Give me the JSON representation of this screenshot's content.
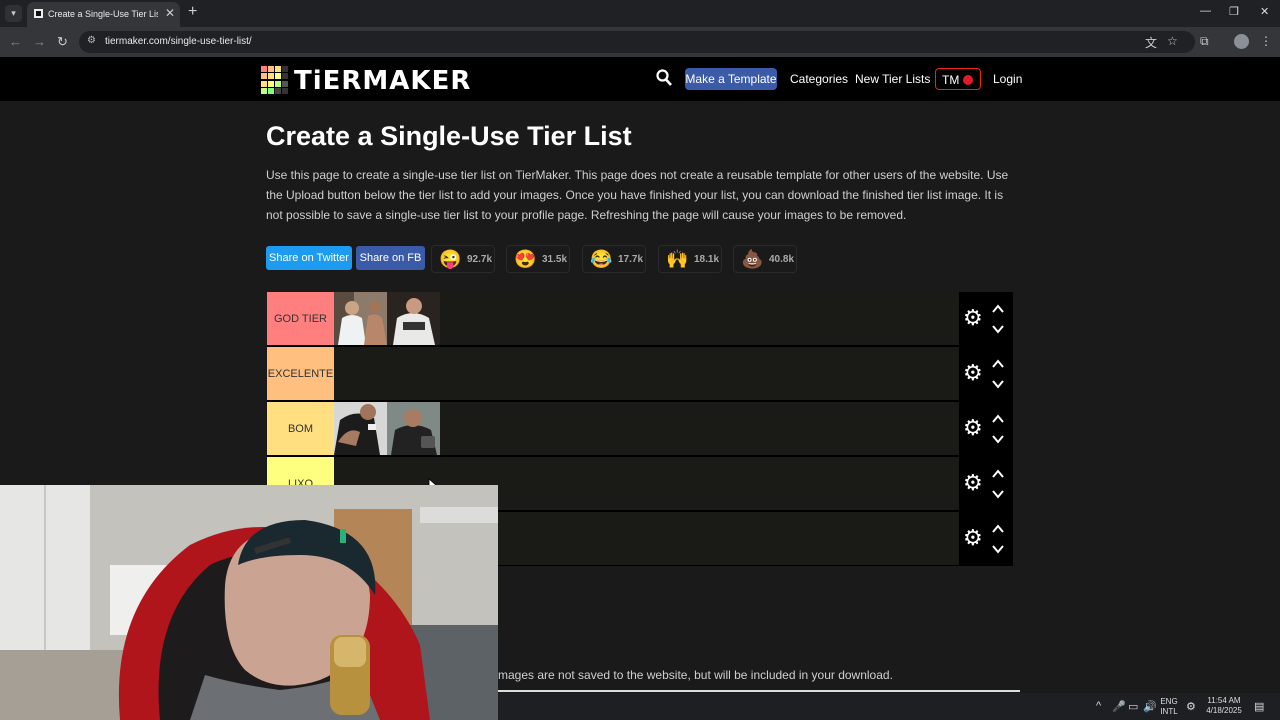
{
  "browser": {
    "tab_title": "Create a Single-Use Tier List (Pr",
    "url": "tiermaker.com/single-use-tier-list/"
  },
  "header": {
    "logo_text": "TiERMAKER",
    "make_template": "Make a Template",
    "categories": "Categories",
    "new_tier_lists": "New Tier Lists",
    "tm": "TM",
    "login": "Login"
  },
  "page": {
    "title": "Create a Single-Use Tier List",
    "intro": "Use this page to create a single-use tier list on TierMaker. This page does not create a reusable template for other users of the website. Use the Upload button below the tier list to add your images. Once you have finished your list, you can download the finished tier list image. It is not possible to save a single-use tier list to your profile page. Refreshing the page will cause your images to be removed.",
    "share_twitter": "Share on Twitter",
    "share_fb": "Share on FB",
    "reactions": [
      {
        "emoji": "😜",
        "count": "92.7k"
      },
      {
        "emoji": "😍",
        "count": "31.5k"
      },
      {
        "emoji": "😂",
        "count": "17.7k"
      },
      {
        "emoji": "🙌",
        "count": "18.1k"
      },
      {
        "emoji": "💩",
        "count": "40.8k"
      }
    ],
    "upload_note": "mages are not saved to the website, but will be included in your download."
  },
  "tiers": [
    {
      "label": "GOD TIER",
      "color": "#ff7f7f",
      "images": 2
    },
    {
      "label": "EXCELENTE",
      "color": "#ffbf7f",
      "images": 0
    },
    {
      "label": "BOM",
      "color": "#ffdf7f",
      "images": 2
    },
    {
      "label": "LIXO",
      "color": "#ffff7f",
      "images": 0
    },
    {
      "label": "",
      "color": "#bfff7f",
      "images": 0
    }
  ],
  "taskbar": {
    "lang_top": "ENG",
    "lang_bottom": "INTL",
    "time": "11:54 AM",
    "date": "4/18/2025"
  },
  "colors": {
    "accent_blue": "#3b5ba8",
    "twitter": "#1d9bf0",
    "facebook": "#3b5ba8",
    "tm_red": "#e21b2b"
  }
}
